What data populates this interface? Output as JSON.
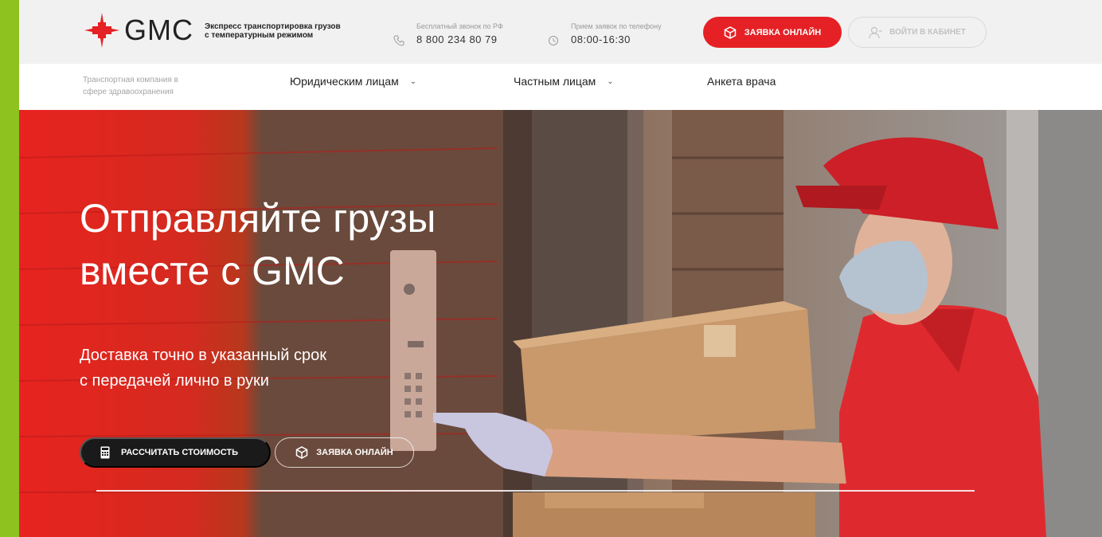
{
  "header": {
    "logo_text": "GMC",
    "tagline_line1": "Экспресс транспортировка грузов",
    "tagline_line2": "с температурным режимом",
    "phone_label": "Бесплатный звонок по РФ",
    "phone_number": "8 800 234 80 79",
    "hours_label": "Прием заявок по телефону",
    "hours_value": "08:00-16:30",
    "request_button": "ЗАЯВКА ОНЛАЙН",
    "login_button": "ВОЙТИ В КАБИНЕТ"
  },
  "nav": {
    "company_line1": "Транспортная компания в",
    "company_line2": "сфере здравоохранения",
    "items": [
      {
        "label": "Юридическим лицам"
      },
      {
        "label": "Частным лицам"
      },
      {
        "label": "Анкета врача"
      }
    ]
  },
  "hero": {
    "title_line1": "Отправляйте грузы",
    "title_line2": "вместе с GMC",
    "subtitle_line1": "Доставка точно в указанный срок",
    "subtitle_line2": "с передачей лично в руки",
    "calc_button": "РАССЧИТАТЬ СТОИМОСТЬ",
    "request_button": "ЗАЯВКА ОНЛАЙН"
  },
  "colors": {
    "brand_red": "#e52125",
    "accent_green": "#8dc21f",
    "dark_button": "#1a1a1a"
  },
  "icons": [
    "cross-logo-icon",
    "phone-icon",
    "clock-icon",
    "box-icon",
    "user-icon",
    "calculator-icon",
    "chevron-down-icon"
  ]
}
